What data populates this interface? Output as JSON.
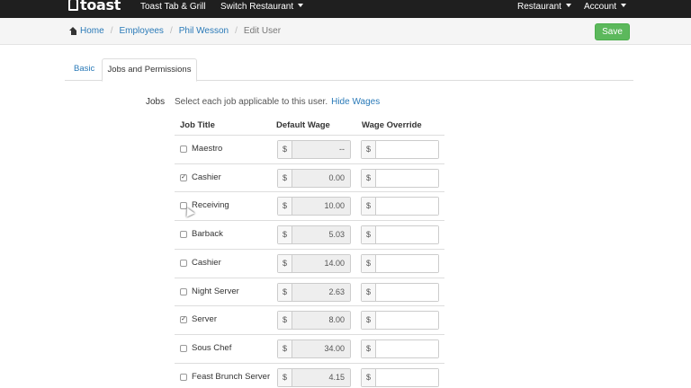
{
  "navbar": {
    "brand": "toast",
    "restaurant_name": "Toast Tab & Grill",
    "switch_restaurant": "Switch Restaurant",
    "restaurant_menu": "Restaurant",
    "account_menu": "Account"
  },
  "breadcrumb": {
    "home": "Home",
    "employees": "Employees",
    "employee": "Phil Wesson",
    "current": "Edit User",
    "separator": "/"
  },
  "save_label": "Save",
  "tabs": [
    {
      "label": "Basic",
      "active": false
    },
    {
      "label": "Jobs and Permissions",
      "active": true
    }
  ],
  "jobs_section": {
    "label": "Jobs",
    "help": "Select each job applicable to this user.",
    "hide_wages": "Hide Wages",
    "headers": {
      "job_title": "Job Title",
      "default_wage": "Default Wage",
      "wage_override": "Wage Override"
    },
    "currency_symbol": "$",
    "jobs": [
      {
        "title": "Maestro",
        "checked": false,
        "default_wage": "--",
        "override": ""
      },
      {
        "title": "Cashier",
        "checked": true,
        "default_wage": "0.00",
        "override": ""
      },
      {
        "title": "Receiving",
        "checked": false,
        "default_wage": "10.00",
        "override": ""
      },
      {
        "title": "Barback",
        "checked": false,
        "default_wage": "5.03",
        "override": ""
      },
      {
        "title": "Cashier",
        "checked": false,
        "default_wage": "14.00",
        "override": ""
      },
      {
        "title": "Night Server",
        "checked": false,
        "default_wage": "2.63",
        "override": ""
      },
      {
        "title": "Server",
        "checked": true,
        "default_wage": "8.00",
        "override": ""
      },
      {
        "title": "Sous Chef",
        "checked": false,
        "default_wage": "34.00",
        "override": ""
      },
      {
        "title": "Feast Brunch Server",
        "checked": false,
        "default_wage": "4.15",
        "override": ""
      }
    ]
  },
  "colors": {
    "navbar_bg": "#1f1f1f",
    "link": "#2a7ab8",
    "save_button": "#5cb85c"
  }
}
